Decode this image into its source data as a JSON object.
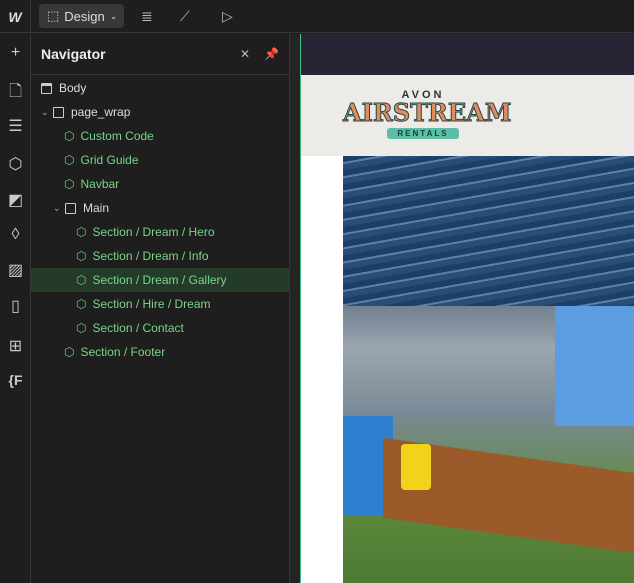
{
  "topbar": {
    "logo": "W",
    "mode_label": "Design",
    "icons": [
      "database-icon",
      "analytics-icon",
      "preview-play-icon"
    ]
  },
  "leftbar": {
    "icons": [
      "add-icon",
      "pages-icon",
      "navigator-icon",
      "components-icon",
      "styles-icon",
      "variables-icon",
      "assets-icon",
      "cms-icon",
      "apps-icon",
      "code-icon"
    ],
    "code_label": "{F"
  },
  "navigator": {
    "title": "Navigator",
    "items": [
      {
        "label": "Body",
        "type": "body",
        "depth": 0
      },
      {
        "label": "page_wrap",
        "type": "div",
        "depth": 0,
        "expanded": true
      },
      {
        "label": "Custom Code",
        "type": "component",
        "depth": 1
      },
      {
        "label": "Grid Guide",
        "type": "component",
        "depth": 1
      },
      {
        "label": "Navbar",
        "type": "component",
        "depth": 1
      },
      {
        "label": "Main",
        "type": "div",
        "depth": 1,
        "expanded": true
      },
      {
        "label": "Section / Dream / Hero",
        "type": "component",
        "depth": 2
      },
      {
        "label": "Section / Dream / Info",
        "type": "component",
        "depth": 2
      },
      {
        "label": "Section / Dream / Gallery",
        "type": "component",
        "depth": 2,
        "selected": true
      },
      {
        "label": "Section / Hire / Dream",
        "type": "component",
        "depth": 2
      },
      {
        "label": "Section / Contact",
        "type": "component",
        "depth": 2
      },
      {
        "label": "Section / Footer",
        "type": "component",
        "depth": 1
      }
    ]
  },
  "canvas": {
    "brand_top": "AVON",
    "brand_main": "AIRSTREAM",
    "brand_sub": "RENTALS"
  }
}
